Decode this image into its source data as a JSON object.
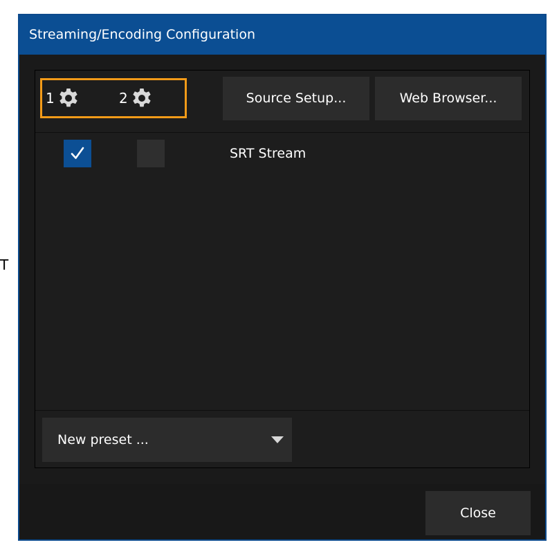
{
  "dialog": {
    "title": "Streaming/Encoding Configuration"
  },
  "toolbar": {
    "config_items": [
      {
        "number": "1",
        "icon": "gear-icon"
      },
      {
        "number": "2",
        "icon": "gear-icon"
      }
    ],
    "highlight_color": "#f39b18",
    "source_setup_label": "Source Setup...",
    "web_browser_label": "Web Browser..."
  },
  "streams": [
    {
      "enabled_1": true,
      "enabled_2": false,
      "name": "SRT Stream"
    }
  ],
  "preset": {
    "selected": "New preset ..."
  },
  "footer": {
    "close_label": "Close"
  },
  "background": {
    "stray_letter": "T"
  },
  "colors": {
    "title_bar": "#0b4e93",
    "checkbox_checked": "#0c4f94",
    "dialog_bg": "#1a1a1a"
  }
}
